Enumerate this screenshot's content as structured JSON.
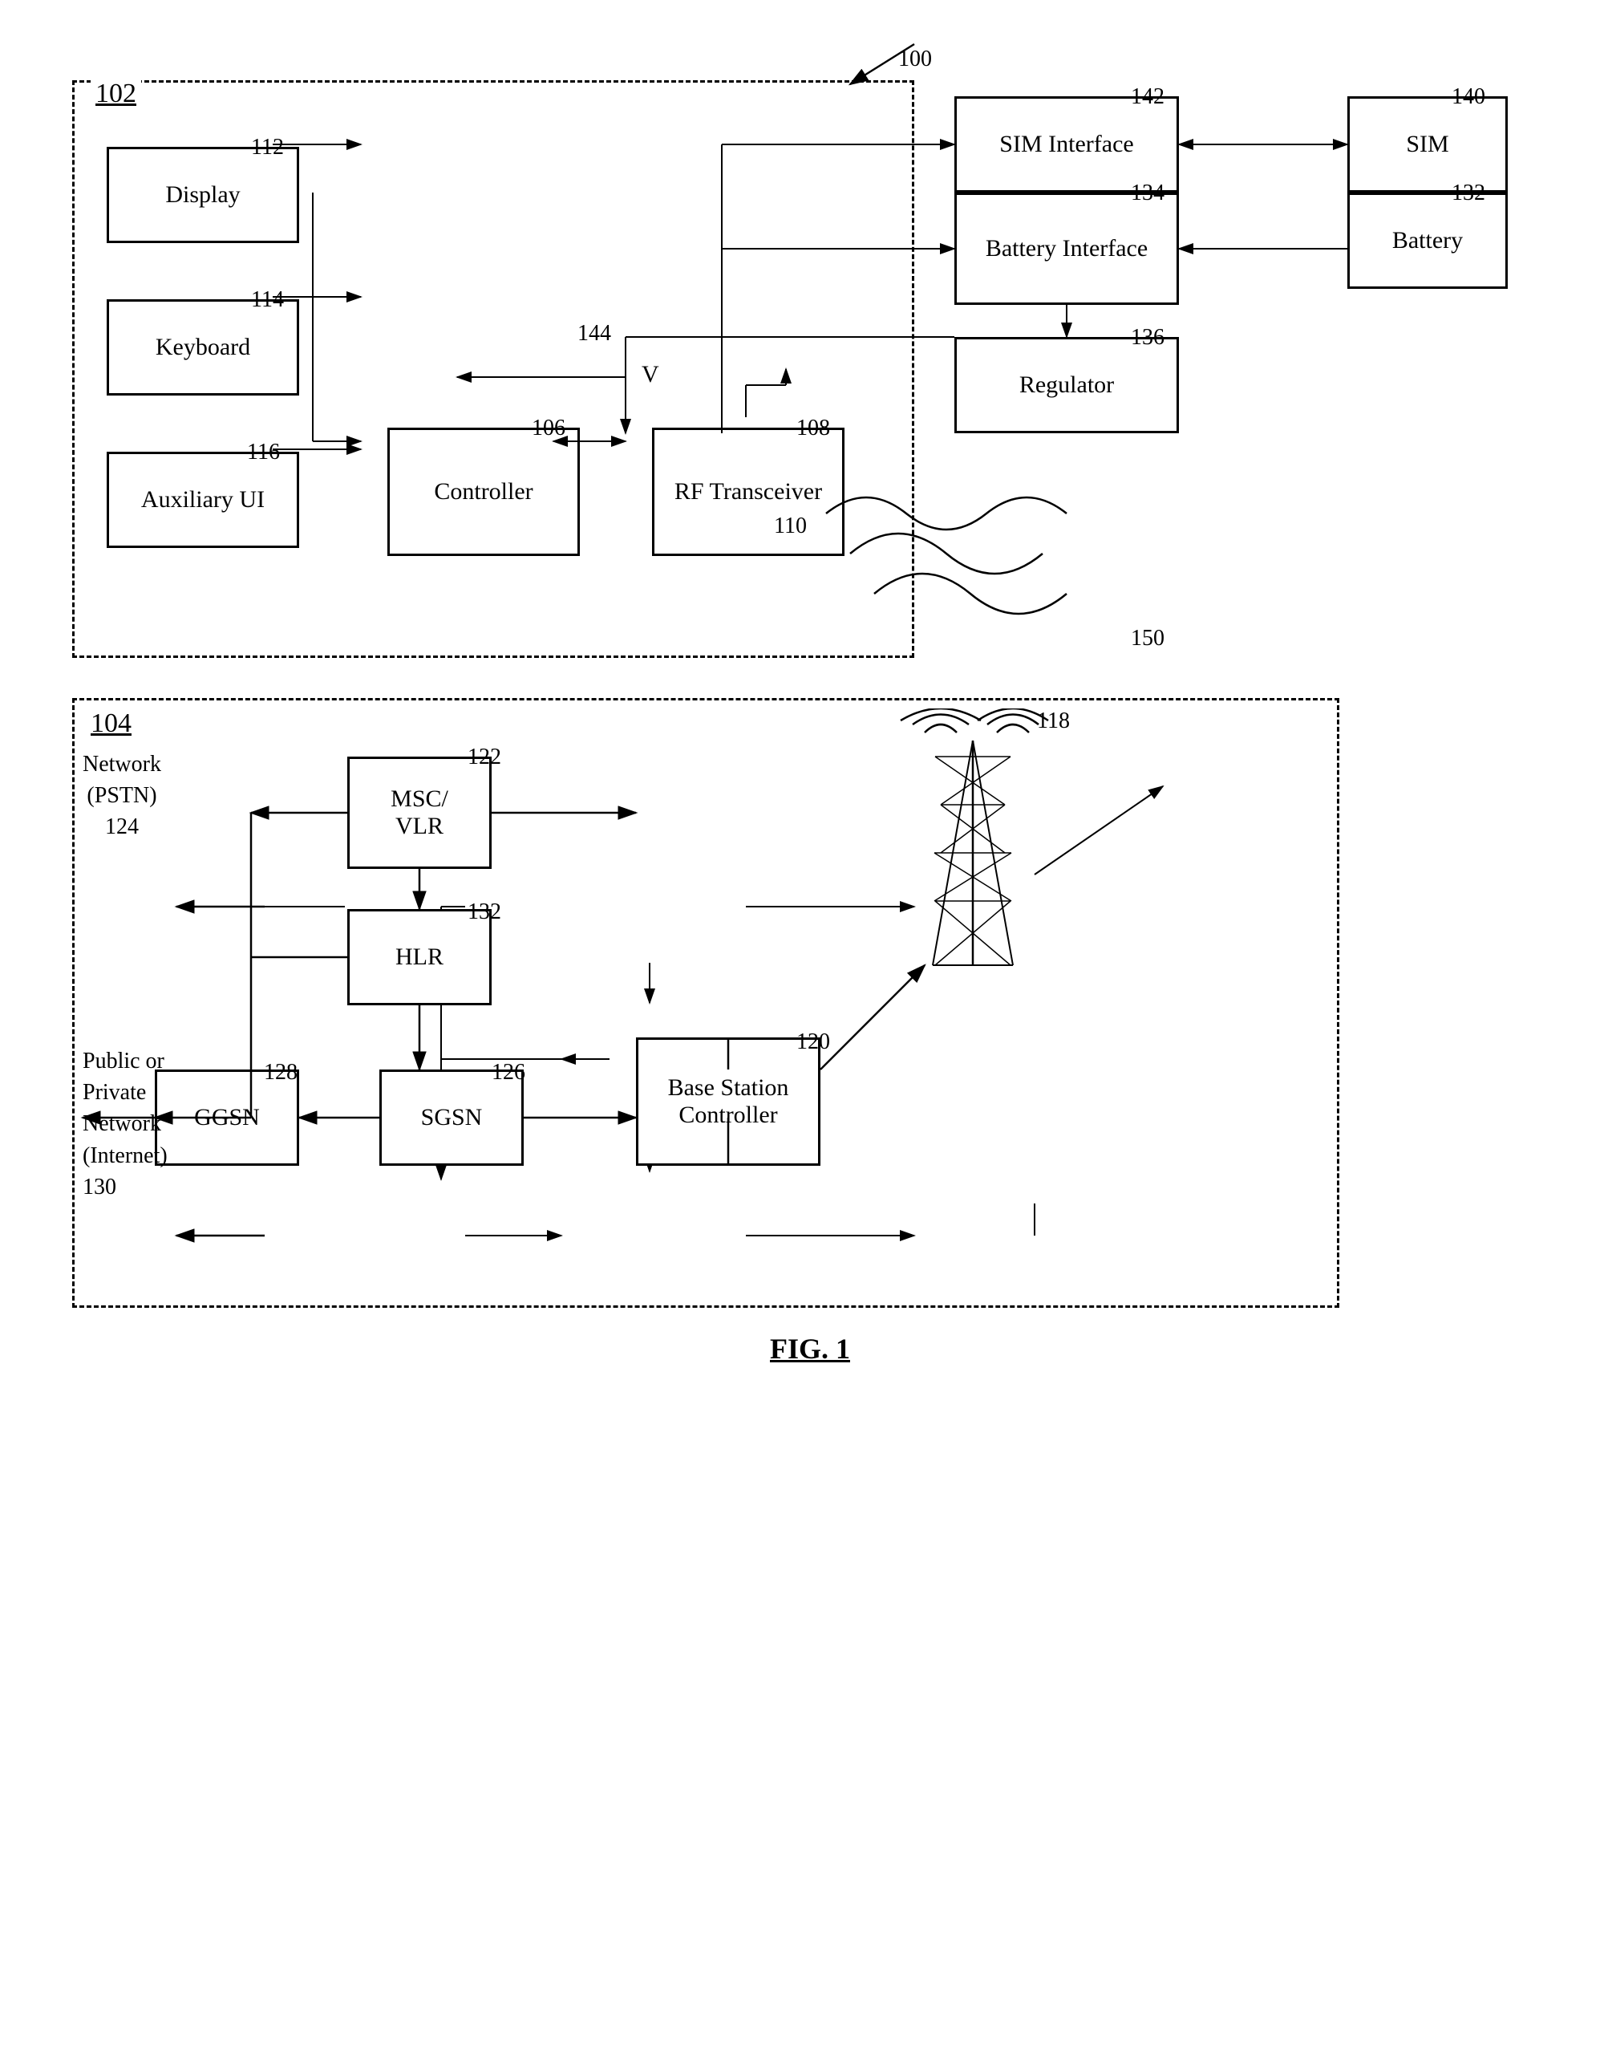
{
  "diagram": {
    "title": "FIG. 1",
    "top_label": "100",
    "mobile_device": {
      "label": "102",
      "blocks": {
        "display": {
          "label": "Display",
          "ref": "112"
        },
        "keyboard": {
          "label": "Keyboard",
          "ref": "114"
        },
        "aux_ui": {
          "label": "Auxiliary UI",
          "ref": "116"
        },
        "controller": {
          "label": "Controller",
          "ref": "106"
        },
        "rf_transceiver": {
          "label": "RF Transceiver",
          "ref": "108"
        }
      }
    },
    "sim_interface": {
      "label": "SIM Interface",
      "ref": "142"
    },
    "battery_interface": {
      "label": "Battery Interface",
      "ref": "134"
    },
    "regulator": {
      "label": "Regulator",
      "ref": "136"
    },
    "sim": {
      "label": "SIM",
      "ref": "140"
    },
    "battery": {
      "label": "Battery",
      "ref": "132"
    },
    "controller_ref": "144",
    "antenna_ref": "110",
    "antenna_ref2": "108",
    "wireless_ref": "150",
    "voltage_label": "V",
    "network": {
      "label": "104",
      "msc_vlr": {
        "label": "MSC/\nVLR",
        "ref": "122"
      },
      "hlr": {
        "label": "HLR",
        "ref": "132"
      },
      "ggsn": {
        "label": "GGSN",
        "ref": "128"
      },
      "sgsn": {
        "label": "SGSN",
        "ref": "126"
      },
      "base_station": {
        "label": "Base Station Controller",
        "ref": "120"
      },
      "network_pstn": {
        "label": "Network\n(PSTN)\n124"
      },
      "network_internet": {
        "label": "Public or\nPrivate\nNetwork\n(Internet)\n130"
      },
      "antenna_ref": "118"
    }
  }
}
